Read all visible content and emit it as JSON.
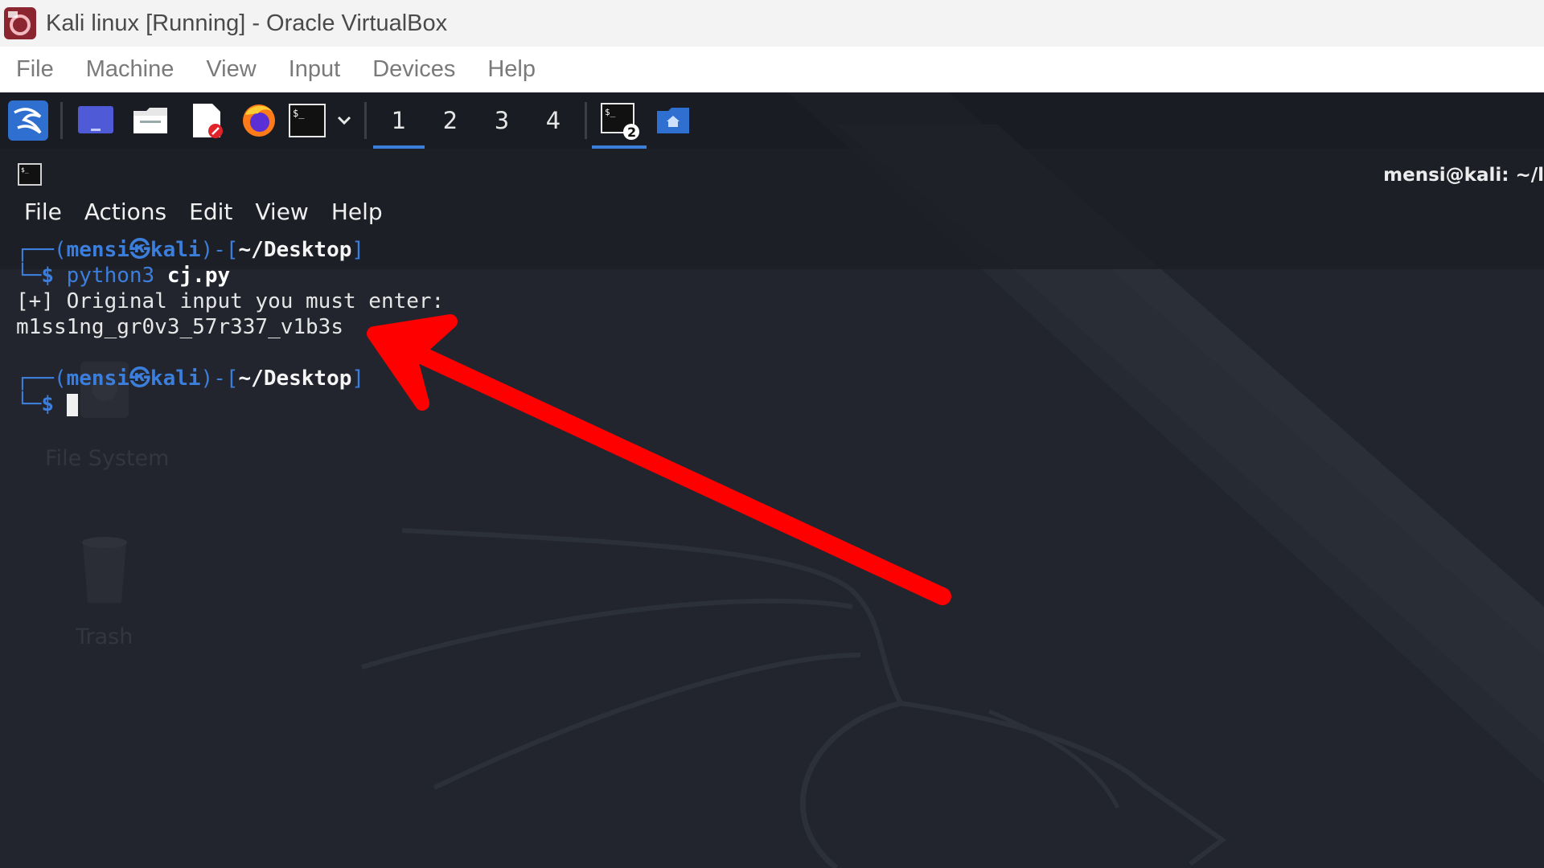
{
  "vbox": {
    "title": "Kali linux [Running] - Oracle VirtualBox",
    "menu": [
      "File",
      "Machine",
      "View",
      "Input",
      "Devices",
      "Help"
    ]
  },
  "panel": {
    "workspaces": [
      "1",
      "2",
      "3",
      "4"
    ],
    "active_workspace": "1",
    "terminal_badge": "2",
    "icons": [
      "kali-menu-icon",
      "desktop-icon",
      "file-manager-icon",
      "text-editor-icon",
      "firefox-icon",
      "terminal-icon",
      "chevron-down-icon",
      "terminal-window-icon",
      "home-folder-icon"
    ]
  },
  "desktop": {
    "icons": [
      {
        "label": "File System"
      },
      {
        "label": "Trash"
      }
    ]
  },
  "terminal": {
    "title": "mensi@kali: ~/l",
    "menu": [
      "File",
      "Actions",
      "Edit",
      "View",
      "Help"
    ],
    "prompt1": {
      "user": "mensi",
      "host": "kali",
      "path": "~/Desktop",
      "cmd": "python3",
      "arg": "cj.py"
    },
    "output": [
      "[+] Original input you must enter:",
      "m1ss1ng_gr0v3_57r337_v1b3s"
    ],
    "prompt2": {
      "user": "mensi",
      "host": "kali",
      "path": "~/Desktop"
    }
  },
  "colors": {
    "accent": "#3c7edb",
    "annotation_arrow": "#ff0000",
    "terminal_bg": "#23262e"
  }
}
